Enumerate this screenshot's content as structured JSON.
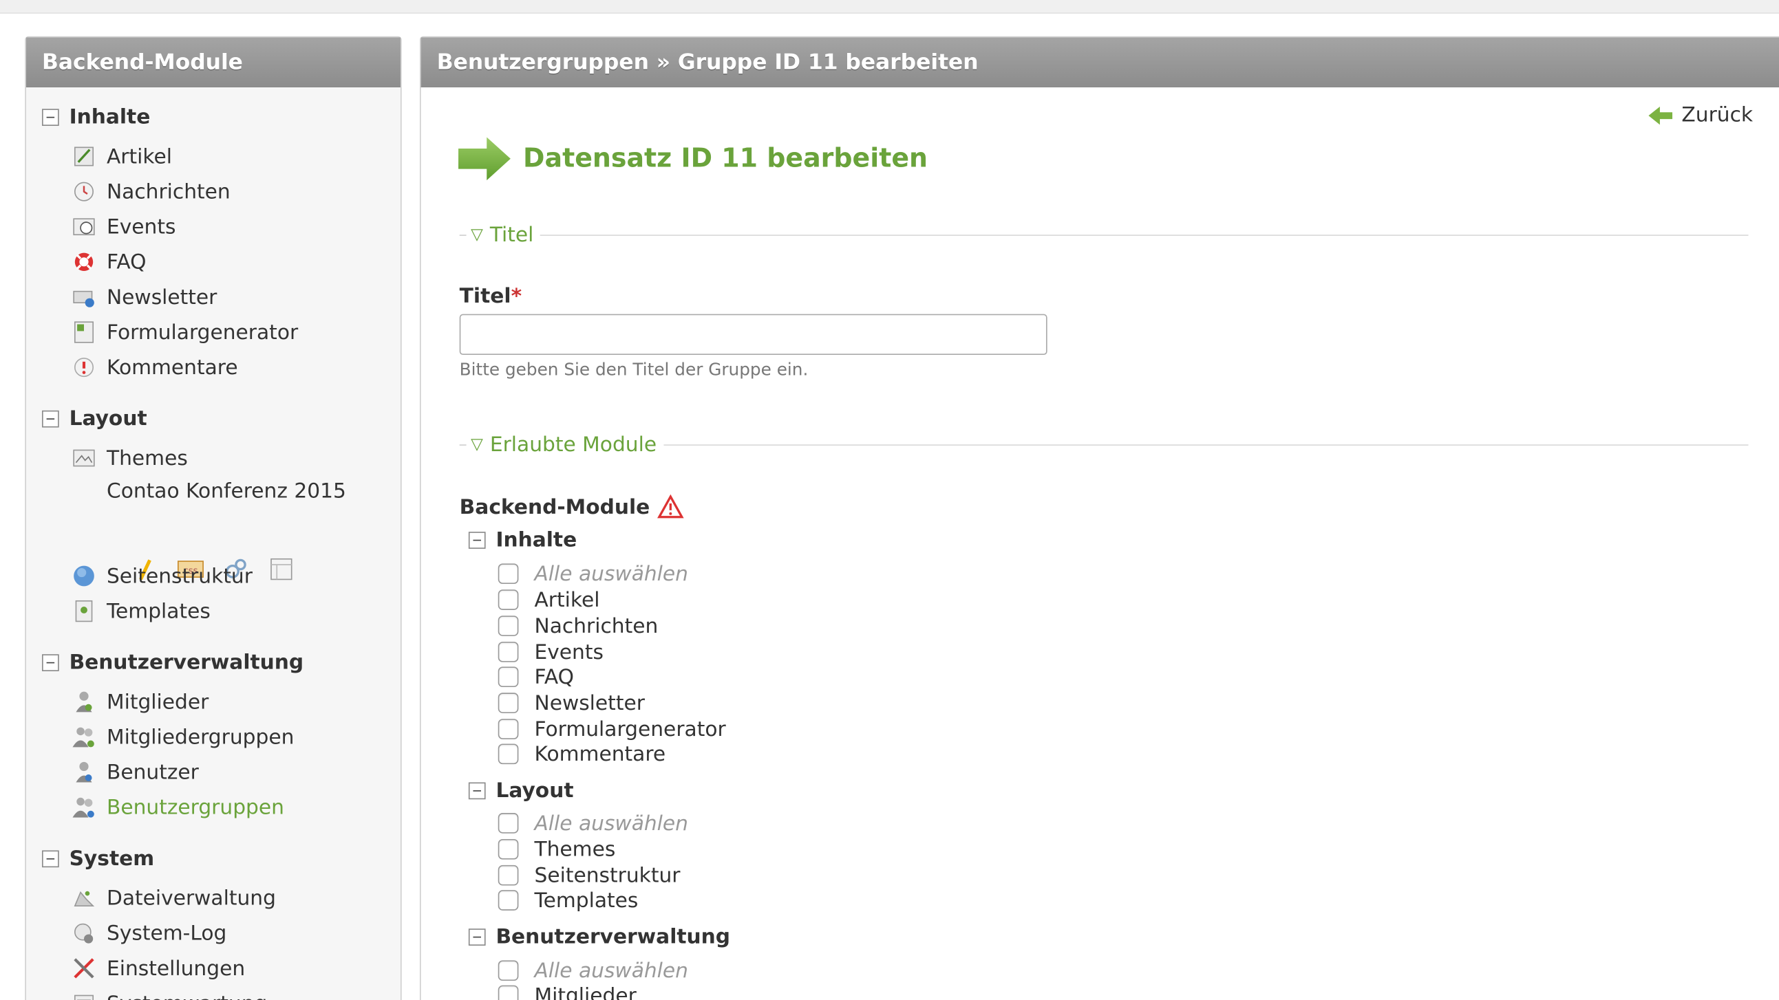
{
  "left_panel": {
    "title": "Backend-Module",
    "groups": [
      {
        "label": "Inhalte",
        "items": [
          "Artikel",
          "Nachrichten",
          "Events",
          "FAQ",
          "Newsletter",
          "Formulargenerator",
          "Kommentare"
        ]
      },
      {
        "label": "Layout",
        "items": [
          "Themes",
          "Seitenstruktur",
          "Templates"
        ],
        "theme_name": "Contao Konferenz 2015"
      },
      {
        "label": "Benutzerverwaltung",
        "items": [
          "Mitglieder",
          "Mitgliedergruppen",
          "Benutzer",
          "Benutzergruppen"
        ],
        "active": "Benutzergruppen"
      },
      {
        "label": "System",
        "items": [
          "Dateiverwaltung",
          "System-Log",
          "Einstellungen",
          "Systemwartung"
        ]
      }
    ]
  },
  "main": {
    "title": "Benutzergruppen » Gruppe ID 11 bearbeiten",
    "back_label": "Zurück",
    "heading": "Datensatz ID 11 bearbeiten",
    "section_title": "Titel",
    "field_title_label": "Titel",
    "field_title_required": "*",
    "field_title_value": "",
    "field_title_help": "Bitte geben Sie den Titel der Gruppe ein.",
    "section_modules": "Erlaubte Module",
    "modules_label": "Backend-Module",
    "select_all": "Alle auswählen",
    "module_groups": [
      {
        "label": "Inhalte",
        "items": [
          "Artikel",
          "Nachrichten",
          "Events",
          "FAQ",
          "Newsletter",
          "Formulargenerator",
          "Kommentare"
        ]
      },
      {
        "label": "Layout",
        "items": [
          "Themes",
          "Seitenstruktur",
          "Templates"
        ]
      },
      {
        "label": "Benutzerverwaltung",
        "items": [
          "Mitglieder"
        ]
      }
    ]
  },
  "colors": {
    "accent": "#6aa33b",
    "header": "#959595",
    "required": "#cc3333"
  }
}
